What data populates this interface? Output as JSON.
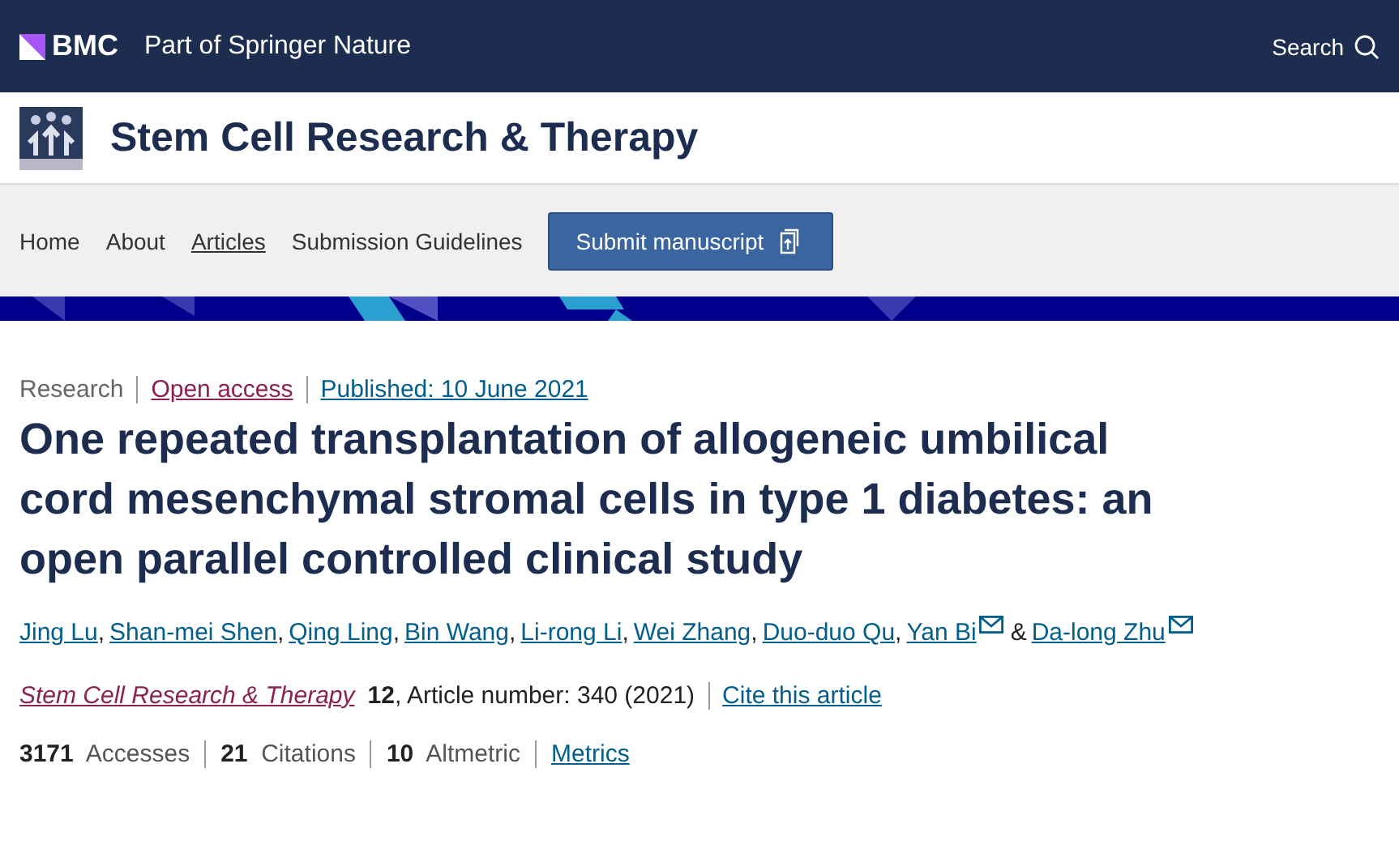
{
  "header": {
    "brand": "BMC",
    "tagline": "Part of Springer Nature",
    "search": "Search"
  },
  "journal": {
    "title": "Stem Cell Research & Therapy"
  },
  "nav": {
    "items": [
      {
        "label": "Home",
        "selected": false
      },
      {
        "label": "About",
        "selected": false
      },
      {
        "label": "Articles",
        "selected": true
      },
      {
        "label": "Submission Guidelines",
        "selected": false
      }
    ],
    "submit": "Submit manuscript"
  },
  "article": {
    "type": "Research",
    "access": "Open access",
    "published": "Published: 10 June 2021",
    "title": "One repeated transplantation of allogeneic umbilical cord mesenchymal stromal cells in type 1 diabetes: an open parallel controlled clinical study",
    "authors": [
      {
        "name": "Jing Lu",
        "email": false,
        "after": ","
      },
      {
        "name": "Shan-mei Shen",
        "email": false,
        "after": ","
      },
      {
        "name": "Qing Ling",
        "email": false,
        "after": ","
      },
      {
        "name": "Bin Wang",
        "email": false,
        "after": ","
      },
      {
        "name": "Li-rong Li",
        "email": false,
        "after": ","
      },
      {
        "name": "Wei Zhang",
        "email": false,
        "after": ","
      },
      {
        "name": "Duo-duo Qu",
        "email": false,
        "after": ","
      },
      {
        "name": "Yan Bi",
        "email": true,
        "after": "&"
      },
      {
        "name": "Da-long Zhu",
        "email": true
      }
    ],
    "citation": {
      "journal": "Stem Cell Research & Therapy",
      "details": "**12**, Article number: 340 (2021)",
      "cite": "Cite this article"
    },
    "metrics": [
      "**3171**  Accesses",
      "**21**  Citations",
      "**10**  Altmetric"
    ],
    "metrics_link": "Metrics"
  }
}
